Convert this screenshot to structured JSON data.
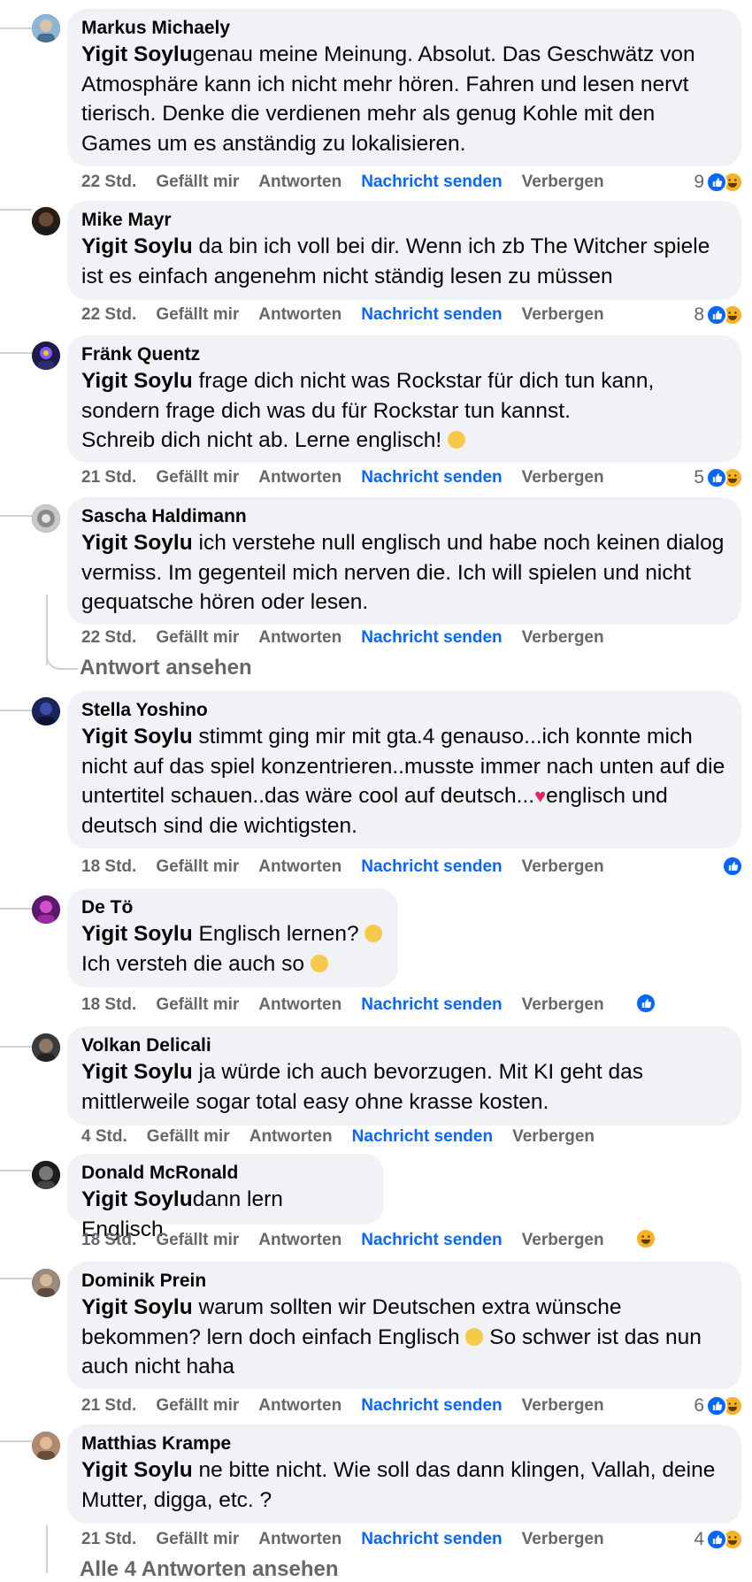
{
  "comments": [
    {
      "author": "Markus Michaely",
      "mention": "Yigit Soylu",
      "text": "genau meine Meinung. Absolut. Das Geschwätz von Atmosphäre kann ich nicht mehr hören. Fahren und lesen nervt tierisch. Denke die verdienen mehr als genug Kohle mit den Games um es anständig zu lokalisieren.",
      "time": "22 Std.",
      "like": "Gefällt mir",
      "reply": "Antworten",
      "message": "Nachricht senden",
      "hide": "Verbergen",
      "reactions": "9"
    },
    {
      "author": "Mike Mayr",
      "mention": "Yigit Soylu",
      "text": " da bin ich voll bei dir. Wenn ich zb The Witcher spiele ist es einfach angenehm nicht ständig lesen zu müssen",
      "time": "22 Std.",
      "like": "Gefällt mir",
      "reply": "Antworten",
      "message": "Nachricht senden",
      "hide": "Verbergen",
      "reactions": "8"
    },
    {
      "author": "Fränk Quentz",
      "mention": "Yigit Soylu",
      "text": " frage dich nicht was Rockstar für dich tun kann, sondern frage dich was du für Rockstar tun kannst.",
      "text2": "Schreib dich nicht ab. Lerne englisch!",
      "time": "21 Std.",
      "like": "Gefällt mir",
      "reply": "Antworten",
      "message": "Nachricht senden",
      "hide": "Verbergen",
      "reactions": "5"
    },
    {
      "author": "Sascha Haldimann",
      "mention": "Yigit Soylu",
      "text": " ich verstehe null englisch und habe noch keinen dialog vermiss. Im gegenteil mich nerven die. Ich will spielen und nicht gequatsche hören oder lesen.",
      "time": "22 Std.",
      "like": "Gefällt mir",
      "reply": "Antworten",
      "message": "Nachricht senden",
      "hide": "Verbergen",
      "view_replies": "Antwort ansehen"
    },
    {
      "author": "Stella Yoshino",
      "mention": "Yigit Soylu",
      "text": " stimmt ging mir mit gta.4 genauso...ich konnte mich nicht auf das spiel konzentrieren..musste immer nach unten auf die untertitel schauen..das wäre cool auf deutsch...",
      "text2": "englisch und deutsch sind die wichtigsten.",
      "time": "18 Std.",
      "like": "Gefällt mir",
      "reply": "Antworten",
      "message": "Nachricht senden",
      "hide": "Verbergen"
    },
    {
      "author": "De Tö",
      "mention": "Yigit Soylu",
      "text": " Englisch lernen?",
      "text2": "Ich versteh die auch so",
      "time": "18 Std.",
      "like": "Gefällt mir",
      "reply": "Antworten",
      "message": "Nachricht senden",
      "hide": "Verbergen"
    },
    {
      "author": "Volkan Delicali",
      "mention": "Yigit Soylu",
      "text": " ja würde ich auch bevorzugen. Mit KI geht das mittlerweile sogar total easy ohne krasse kosten.",
      "time": "4 Std.",
      "like": "Gefällt mir",
      "reply": "Antworten",
      "message": "Nachricht senden",
      "hide": "Verbergen"
    },
    {
      "author": "Donald McRonald",
      "mention": "Yigit Soylu",
      "text": "dann lern Englisch",
      "time": "18 Std.",
      "like": "Gefällt mir",
      "reply": "Antworten",
      "message": "Nachricht senden",
      "hide": "Verbergen"
    },
    {
      "author": "Dominik Prein",
      "mention": "Yigit Soylu",
      "text": " warum sollten wir Deutschen extra wünsche bekommen? lern doch einfach Englisch",
      "text2": " So schwer ist das nun auch nicht haha",
      "time": "21 Std.",
      "like": "Gefällt mir",
      "reply": "Antworten",
      "message": "Nachricht senden",
      "hide": "Verbergen",
      "reactions": "6"
    },
    {
      "author": "Matthias Krampe",
      "mention": "Yigit Soylu",
      "text": " ne bitte nicht. Wie soll das dann klingen, Vallah, deine Mutter, digga, etc. ?",
      "time": "21 Std.",
      "like": "Gefällt mir",
      "reply": "Antworten",
      "message": "Nachricht senden",
      "hide": "Verbergen",
      "reactions": "4",
      "view_replies": "Alle 4 Antworten ansehen"
    }
  ],
  "colors": {
    "bubble": "#f0f2f5",
    "link": "#0866ff",
    "meta": "#65676b",
    "like_blue": "#0866ff",
    "haha_yellow": "#f7b125"
  }
}
